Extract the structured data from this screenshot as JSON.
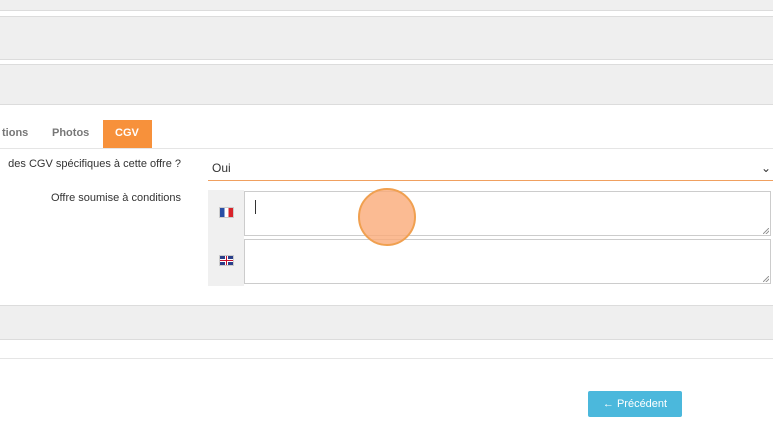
{
  "tabs": [
    {
      "label": "tions"
    },
    {
      "label": "Photos"
    },
    {
      "label": "CGV"
    }
  ],
  "form": {
    "cgv_question": "des CGV spécifiques à cette offre ?",
    "cgv_select_value": "Oui",
    "conditions_label": "Offre soumise à conditions",
    "conditions_fr_value": "",
    "conditions_en_value": ""
  },
  "footer": {
    "previous_label": "← Précédent"
  },
  "colors": {
    "active_tab": "#f7913b",
    "primary_button": "#4bb8dc"
  }
}
